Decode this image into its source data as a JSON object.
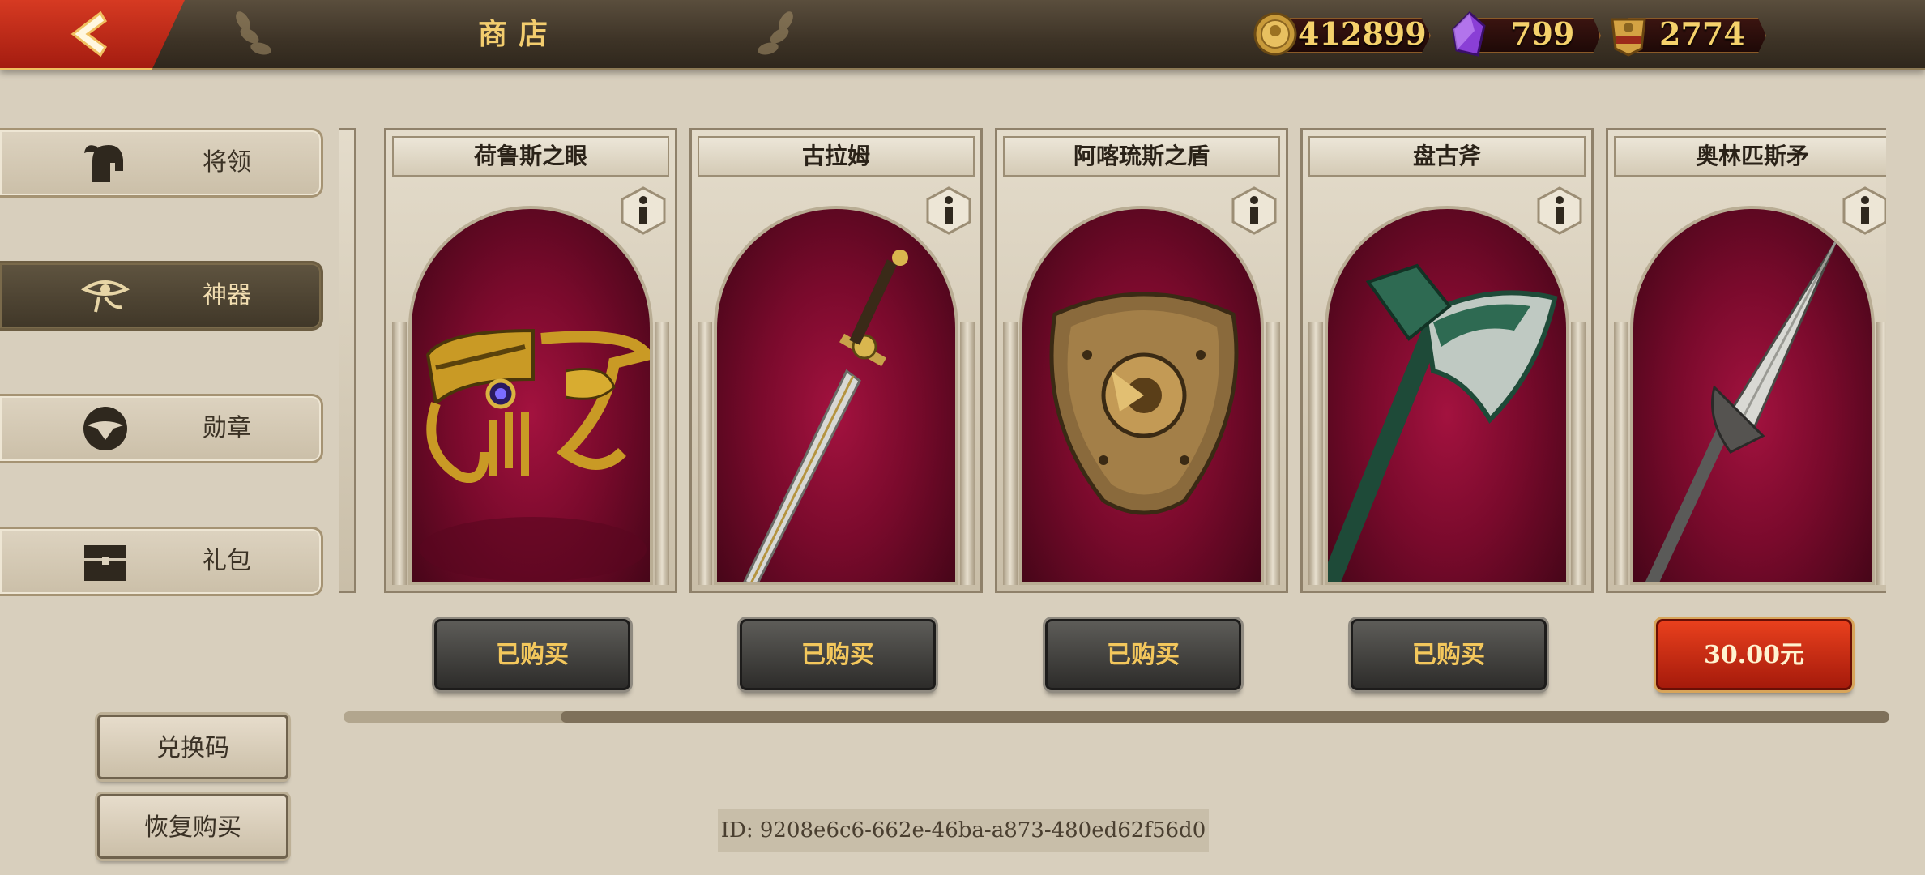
{
  "header": {
    "title": "商店",
    "currencies": [
      {
        "icon": "gold-coin-icon",
        "value": "412899"
      },
      {
        "icon": "purple-gem-icon",
        "value": "799"
      },
      {
        "icon": "spqr-token-icon",
        "value": "2774"
      }
    ]
  },
  "sidebar": {
    "items": [
      {
        "label": "将领",
        "icon": "spartan-helmet-icon",
        "active": false
      },
      {
        "label": "神器",
        "icon": "eye-of-horus-icon",
        "active": true
      },
      {
        "label": "勋章",
        "icon": "eagle-medal-icon",
        "active": false
      },
      {
        "label": "礼包",
        "icon": "treasure-chest-icon",
        "active": false
      }
    ],
    "redeem_label": "兑换码",
    "restore_label": "恢复购买"
  },
  "products": [
    {
      "name": "荷鲁斯之眼",
      "button": "已购买",
      "purchased": true,
      "item": "eye-of-horus-artifact"
    },
    {
      "name": "古拉姆",
      "button": "已购买",
      "purchased": true,
      "item": "sword"
    },
    {
      "name": "阿喀琉斯之盾",
      "button": "已购买",
      "purchased": true,
      "item": "shield"
    },
    {
      "name": "盘古斧",
      "button": "已购买",
      "purchased": true,
      "item": "axe"
    },
    {
      "name": "奥林匹斯矛",
      "button": "30.00元",
      "purchased": false,
      "item": "spear"
    }
  ],
  "footer": {
    "id_text": "ID: 9208e6c6-662e-46ba-a873-480ed62f56d0"
  },
  "colors": {
    "accent_gold": "#f3cd6e",
    "buy_red": "#c82a12",
    "panel_bg": "#d8cfbd"
  }
}
